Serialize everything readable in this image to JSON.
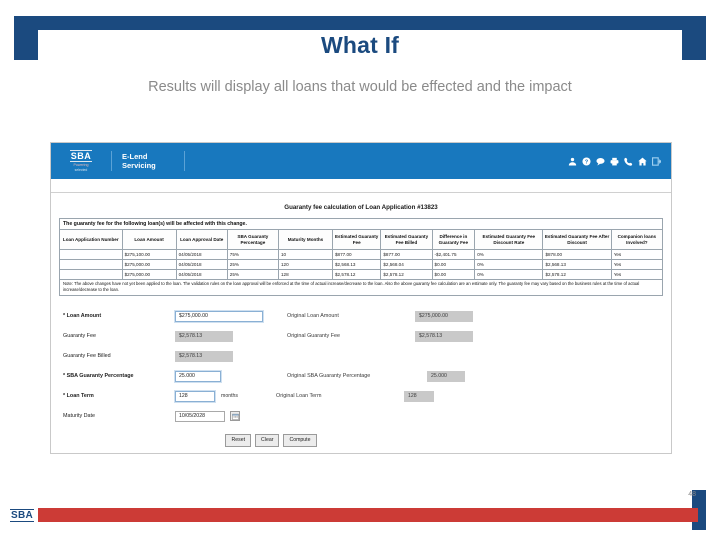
{
  "slide": {
    "title": "What If",
    "subtitle": "Results will display all loans that would be effected and the impact",
    "page_number": "48",
    "footer_logo": "SBA",
    "accent_blue": "#1b4a7f",
    "accent_red": "#cc3b36"
  },
  "app": {
    "brand": {
      "logo": "SBA",
      "logo_tagline": "Powering",
      "logo_sub": "selected",
      "app_name": "E-Lend\nServicing",
      "header_color": "#1878be"
    },
    "header_icons": [
      "user-icon",
      "help-icon",
      "chat-icon",
      "print-icon",
      "phone-icon",
      "home-icon",
      "logout-icon"
    ],
    "calc_title": "Guaranty fee calculation of Loan Application #13823",
    "table": {
      "banner": "The guaranty fee for the following loan(s) will be affected with this change.",
      "columns": [
        "Loan Application Number",
        "Loan Amount",
        "Loan Approval Date",
        "SBA Guaranty Percentage",
        "Maturity Months",
        "Estimated Guaranty Fee",
        "Estimated Guaranty Fee Billed",
        "Difference in Guaranty Fee",
        "Estimated Guaranty Fee Discount Rate",
        "Estimated Guaranty Fee After Discount",
        "Companion loans Involved?"
      ],
      "rows": [
        {
          "loan_application_number": "",
          "loan_amount": "$275,100.00",
          "loan_approval_date": "04/05/2018",
          "sba_guaranty_percentage": "75%",
          "maturity_months": "10",
          "estimated_guaranty_fee": "$877.00",
          "estimated_guaranty_fee_billed": "$877.00",
          "difference_in_guaranty_fee": "-$2,401.75",
          "guaranty_fee_discount_rate": "0%",
          "guaranty_fee_after_discount": "$878.00",
          "companion_loans": "Yes"
        },
        {
          "loan_application_number": "",
          "loan_amount": "$275,000.00",
          "loan_approval_date": "04/05/2018",
          "sba_guaranty_percentage": "25%",
          "maturity_months": "120",
          "estimated_guaranty_fee": "$2,568.13",
          "estimated_guaranty_fee_billed": "$2,568.04",
          "difference_in_guaranty_fee": "$0.00",
          "guaranty_fee_discount_rate": "0%",
          "guaranty_fee_after_discount": "$2,568.13",
          "companion_loans": "Yes"
        },
        {
          "loan_application_number": "",
          "loan_amount": "$275,000.00",
          "loan_approval_date": "04/05/2018",
          "sba_guaranty_percentage": "25%",
          "maturity_months": "128",
          "estimated_guaranty_fee": "$2,578.12",
          "estimated_guaranty_fee_billed": "$2,578.12",
          "difference_in_guaranty_fee": "$0.00",
          "guaranty_fee_discount_rate": "0%",
          "guaranty_fee_after_discount": "$2,578.12",
          "companion_loans": "Yes"
        }
      ],
      "note": "Note: The above changes have not yet been applied to the loan. The validation rules on the loan approval will be enforced at the time of actual increase/decrease to the loan. Also the above guaranty fee calculation are an estimate only. The guaranty fee may vary based on the business rules at the time of actual increase/decrease to the loan."
    },
    "form": {
      "fields": [
        {
          "label": "Loan Amount",
          "required": true,
          "value": "$275,000.00",
          "original_label": "Original Loan Amount",
          "original_value": "$275,000.00"
        },
        {
          "label": "Guaranty Fee",
          "required": false,
          "value": "$2,578.13",
          "original_label": "Original Guaranty Fee",
          "original_value": "$2,578.13"
        },
        {
          "label": "Guaranty Fee Billed",
          "required": false,
          "value": "$2,578.13",
          "original_label": "",
          "original_value": ""
        },
        {
          "label": "SBA Guaranty Percentage",
          "required": true,
          "value": "25.000",
          "original_label": "Original SBA Guaranty Percentage",
          "original_value": "25.000"
        },
        {
          "label": "Loan Term",
          "required": true,
          "value": "128",
          "units": "months",
          "original_label": "Original Loan Term",
          "original_value": "128"
        },
        {
          "label": "Maturity Date",
          "required": false,
          "value": "10/05/2028",
          "original_label": "",
          "original_value": ""
        }
      ],
      "buttons": [
        "Reset",
        "Clear",
        "Compute"
      ]
    }
  }
}
